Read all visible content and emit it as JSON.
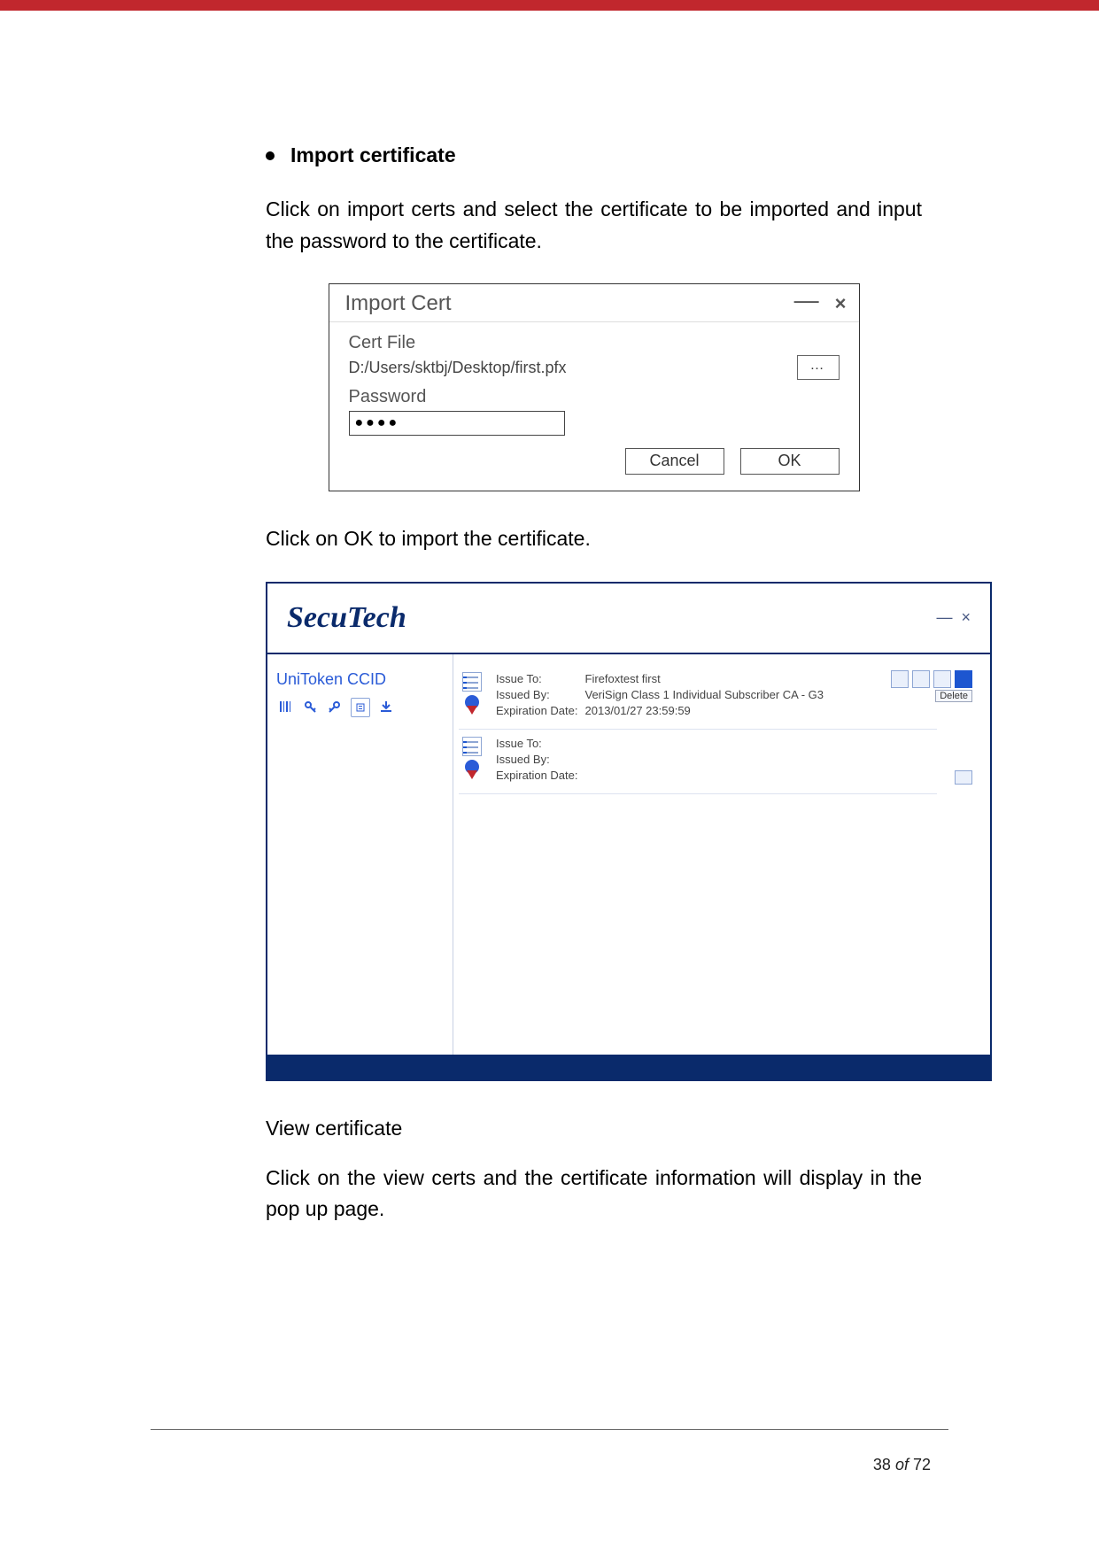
{
  "heading": "Import certificate",
  "para1": "Click on import certs and select the certificate to be imported and input the password to the certificate.",
  "dialog": {
    "title": "Import Cert",
    "minimize": "—",
    "close": "×",
    "cert_file_label": "Cert File",
    "cert_file_value": "D:/Users/sktbj/Desktop/first.pfx",
    "browse_label": "…",
    "password_label": "Password",
    "password_value": "●●●●",
    "cancel_label": "Cancel",
    "ok_label": "OK"
  },
  "para2": "Click on OK to import the certificate.",
  "app": {
    "brand": "SecuTech",
    "win_min": "—",
    "win_close": "×",
    "sidebar_title": "UniToken CCID",
    "delete_label": "Delete",
    "cards": [
      {
        "issue_to_label": "Issue To:",
        "issue_to_value": "Firefoxtest first",
        "issued_by_label": "Issued By:",
        "issued_by_value": "VeriSign Class 1 Individual Subscriber CA - G3",
        "expiration_label": "Expiration Date:",
        "expiration_value": "2013/01/27 23:59:59"
      },
      {
        "issue_to_label": "Issue To:",
        "issue_to_value": "",
        "issued_by_label": "Issued By:",
        "issued_by_value": "",
        "expiration_label": "Expiration Date:",
        "expiration_value": ""
      }
    ]
  },
  "sub_heading": "View certificate",
  "para3": "Click on the view certs and the certificate information will display in the pop up page.",
  "page": {
    "current": "38",
    "sep": "of",
    "total": "72"
  }
}
